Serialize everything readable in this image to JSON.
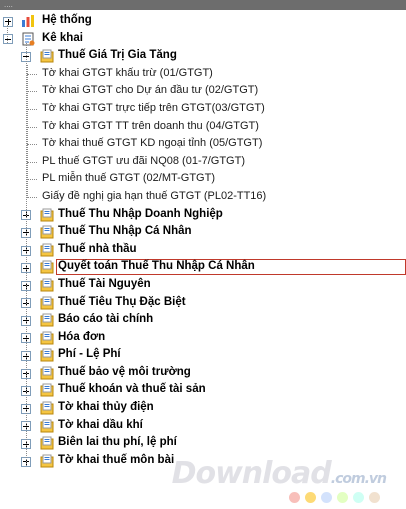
{
  "topbar": {
    "text": "...."
  },
  "tree": {
    "system": "Hệ thống",
    "declare": "Kê khai",
    "vat": "Thuế Giá Trị Gia Tăng",
    "vat_items": [
      "Tờ khai GTGT khấu trừ (01/GTGT)",
      "Tờ khai GTGT cho Dự án đầu tư (02/GTGT)",
      "Tờ khai GTGT trực tiếp trên GTGT(03/GTGT)",
      "Tờ khai GTGT TT trên doanh thu (04/GTGT)",
      "Tờ khai thuế GTGT KD ngoại tỉnh (05/GTGT)",
      "PL thuế GTGT ưu đãi NQ08 (01-7/GTGT)",
      "PL miễn thuế GTGT (02/MT-GTGT)",
      "Giấy đề nghị gia hạn thuế GTGT (PL02-TT16)"
    ],
    "groups": [
      "Thuế Thu Nhập Doanh Nghiệp",
      "Thuế Thu Nhập Cá Nhân",
      "Thuế nhà thầu",
      "Quyết toán Thuế Thu Nhập Cá Nhân",
      "Thuế Tài Nguyên",
      "Thuế Tiêu Thụ Đặc Biệt",
      "Báo cáo tài chính",
      "Hóa đơn",
      "Phí - Lệ Phí",
      "Thuế bảo vệ môi trường",
      "Thuế khoán và thuế tài sản",
      "Tờ khai thủy điện",
      "Tờ khai dầu khí",
      "Biên lai thu phí, lệ phí",
      "Tờ khai thuế môn bài"
    ],
    "selected_index": 3
  },
  "watermark": {
    "brand": "Download",
    "tld": ".com.vn"
  },
  "colors": {
    "selection_border": "#c0392b",
    "dot_colors": [
      "#f28b82",
      "#fbbc04",
      "#aecbfa",
      "#ccff90",
      "#a7ffeb",
      "#e6c9a8"
    ]
  }
}
